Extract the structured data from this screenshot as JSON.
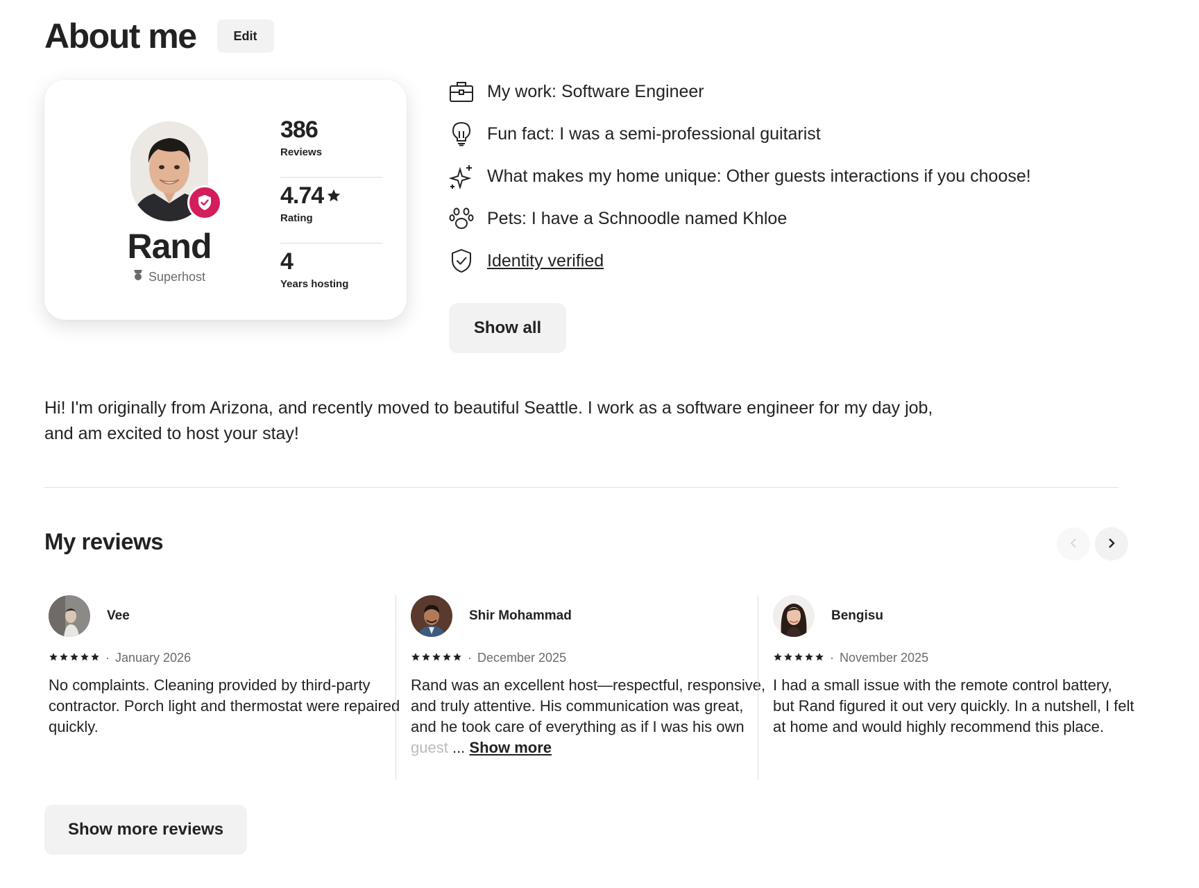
{
  "header": {
    "title": "About me",
    "edit_label": "Edit"
  },
  "profile": {
    "name": "Rand",
    "status": "Superhost",
    "stats": [
      {
        "value": "386",
        "label": "Reviews"
      },
      {
        "value": "4.74",
        "label": "Rating"
      },
      {
        "value": "4",
        "label": "Years hosting"
      }
    ]
  },
  "facts": [
    {
      "icon": "briefcase-icon",
      "text": "My work: Software Engineer"
    },
    {
      "icon": "lightbulb-icon",
      "text": "Fun fact: I was a semi-professional guitarist"
    },
    {
      "icon": "sparkles-icon",
      "text": "What makes my home unique: Other guests interactions if you choose!"
    },
    {
      "icon": "paw-icon",
      "text": "Pets: I have a Schnoodle named Khloe"
    },
    {
      "icon": "shield-check-icon",
      "text": "Identity verified"
    }
  ],
  "show_all_label": "Show all",
  "bio": "Hi! I'm originally from Arizona, and recently moved to beautiful Seattle. I work as a software engineer for my day job, and am excited to host your stay!",
  "reviews_section": {
    "title": "My reviews",
    "reviews": [
      {
        "name": "Vee",
        "rating": 5,
        "date": "January 2026",
        "text": "No complaints. Cleaning provided by third-party contractor. Porch light and thermostat were repaired quickly."
      },
      {
        "name": "Shir Mohammad",
        "rating": 5,
        "date": "December 2025",
        "text": "Rand was an excellent host—respectful, responsive, and truly attentive. His communication was great, and he took care of everything as if I was his own",
        "fade_text": " guest",
        "ellipsis": "...",
        "show_more": "Show more"
      },
      {
        "name": "Bengisu",
        "rating": 5,
        "date": "November 2025",
        "text": "I had a small issue with the remote control battery, but Rand figured it out very quickly. In a nutshell, I felt at home and would highly recommend this place."
      }
    ],
    "separator": "·",
    "show_more_reviews_label": "Show more reviews"
  },
  "colors": {
    "badge": "#d31d5c",
    "button_bg": "#f2f2f2",
    "text": "#222222",
    "muted": "#6a6a6a"
  }
}
